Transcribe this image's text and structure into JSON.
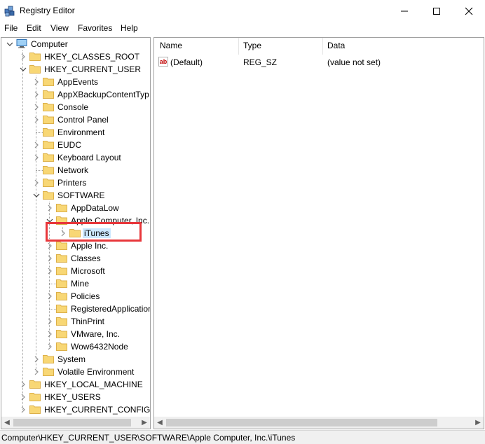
{
  "window": {
    "title": "Registry Editor"
  },
  "menu": [
    "File",
    "Edit",
    "View",
    "Favorites",
    "Help"
  ],
  "tree": [
    {
      "label": "Computer",
      "level": 0,
      "state": "expanded",
      "icon": "computer-icon"
    },
    {
      "label": "HKEY_CLASSES_ROOT",
      "level": 1,
      "state": "collapsed"
    },
    {
      "label": "HKEY_CURRENT_USER",
      "level": 1,
      "state": "expanded"
    },
    {
      "label": "AppEvents",
      "level": 2,
      "state": "collapsed"
    },
    {
      "label": "AppXBackupContentTyp",
      "level": 2,
      "state": "collapsed"
    },
    {
      "label": "Console",
      "level": 2,
      "state": "collapsed"
    },
    {
      "label": "Control Panel",
      "level": 2,
      "state": "collapsed"
    },
    {
      "label": "Environment",
      "level": 2,
      "state": "leaf"
    },
    {
      "label": "EUDC",
      "level": 2,
      "state": "collapsed"
    },
    {
      "label": "Keyboard Layout",
      "level": 2,
      "state": "collapsed"
    },
    {
      "label": "Network",
      "level": 2,
      "state": "leaf"
    },
    {
      "label": "Printers",
      "level": 2,
      "state": "collapsed"
    },
    {
      "label": "SOFTWARE",
      "level": 2,
      "state": "expanded"
    },
    {
      "label": "AppDataLow",
      "level": 3,
      "state": "collapsed"
    },
    {
      "label": "Apple Computer, Inc.",
      "level": 3,
      "state": "expanded"
    },
    {
      "label": "iTunes",
      "level": 4,
      "state": "collapsed",
      "selected": true
    },
    {
      "label": "Apple Inc.",
      "level": 3,
      "state": "collapsed"
    },
    {
      "label": "Classes",
      "level": 3,
      "state": "collapsed"
    },
    {
      "label": "Microsoft",
      "level": 3,
      "state": "collapsed"
    },
    {
      "label": "Mine",
      "level": 3,
      "state": "leaf"
    },
    {
      "label": "Policies",
      "level": 3,
      "state": "collapsed"
    },
    {
      "label": "RegisteredApplication",
      "level": 3,
      "state": "leaf"
    },
    {
      "label": "ThinPrint",
      "level": 3,
      "state": "collapsed"
    },
    {
      "label": "VMware, Inc.",
      "level": 3,
      "state": "collapsed"
    },
    {
      "label": "Wow6432Node",
      "level": 3,
      "state": "collapsed"
    },
    {
      "label": "System",
      "level": 2,
      "state": "collapsed"
    },
    {
      "label": "Volatile Environment",
      "level": 2,
      "state": "collapsed"
    },
    {
      "label": "HKEY_LOCAL_MACHINE",
      "level": 1,
      "state": "collapsed"
    },
    {
      "label": "HKEY_USERS",
      "level": 1,
      "state": "collapsed"
    },
    {
      "label": "HKEY_CURRENT_CONFIG",
      "level": 1,
      "state": "collapsed"
    }
  ],
  "list": {
    "columns": [
      "Name",
      "Type",
      "Data"
    ],
    "rows": [
      {
        "name": "(Default)",
        "type": "REG_SZ",
        "data": "(value not set)",
        "icon": "string-value-icon"
      }
    ]
  },
  "status": {
    "path": "Computer\\HKEY_CURRENT_USER\\SOFTWARE\\Apple Computer, Inc.\\iTunes"
  },
  "colors": {
    "folder": "#f8d775",
    "folder_edge": "#dcb04a",
    "selection": "#cce8ff",
    "highlight": "#e8373b"
  }
}
